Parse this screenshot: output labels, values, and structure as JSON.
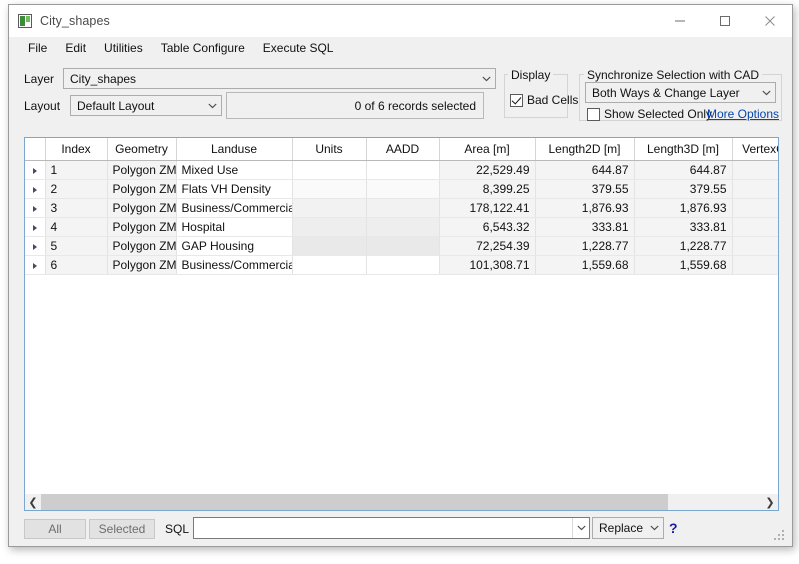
{
  "window": {
    "title": "City_shapes",
    "icon": "table-layer-icon",
    "controls": {
      "minimize": "minimize-icon",
      "maximize": "maximize-icon",
      "close": "close-icon"
    }
  },
  "menubar": {
    "items": [
      "File",
      "Edit",
      "Utilities",
      "Table Configure",
      "Execute SQL"
    ]
  },
  "options": {
    "layer_label": "Layer",
    "layer_value": "City_shapes",
    "layout_label": "Layout",
    "layout_value": "Default Layout",
    "records_status": "0 of 6 records selected",
    "display_group": "Display",
    "bad_cells_label": "Bad Cells",
    "bad_cells_checked": true,
    "sync_group": "Synchronize Selection with CAD",
    "sync_value": "Both Ways & Change Layer",
    "show_selected_only_label": "Show Selected Only",
    "show_selected_only_checked": false,
    "more_options_label": "More Options"
  },
  "grid": {
    "columns": [
      {
        "key": "marker",
        "label": ""
      },
      {
        "key": "index",
        "label": "Index"
      },
      {
        "key": "geometry",
        "label": "Geometry"
      },
      {
        "key": "landuse",
        "label": "Landuse"
      },
      {
        "key": "units",
        "label": "Units"
      },
      {
        "key": "aadd",
        "label": "AADD"
      },
      {
        "key": "area",
        "label": "Area [m]"
      },
      {
        "key": "length2d",
        "label": "Length2D [m]"
      },
      {
        "key": "length3d",
        "label": "Length3D [m]"
      },
      {
        "key": "vertexc",
        "label": "VertexC"
      }
    ],
    "rows": [
      {
        "index": "1",
        "geometry": "Polygon ZM",
        "landuse": "Mixed Use",
        "units": "",
        "aadd": "",
        "area": "22,529.49",
        "length2d": "644.87",
        "length3d": "644.87",
        "vertexc": ""
      },
      {
        "index": "2",
        "geometry": "Polygon ZM",
        "landuse": "Flats VH Density",
        "units": "",
        "aadd": "",
        "area": "8,399.25",
        "length2d": "379.55",
        "length3d": "379.55",
        "vertexc": ""
      },
      {
        "index": "3",
        "geometry": "Polygon ZM",
        "landuse": "Business/Commercial",
        "units": "",
        "aadd": "",
        "area": "178,122.41",
        "length2d": "1,876.93",
        "length3d": "1,876.93",
        "vertexc": ""
      },
      {
        "index": "4",
        "geometry": "Polygon ZM",
        "landuse": "Hospital",
        "units": "",
        "aadd": "",
        "area": "6,543.32",
        "length2d": "333.81",
        "length3d": "333.81",
        "vertexc": ""
      },
      {
        "index": "5",
        "geometry": "Polygon ZM",
        "landuse": "GAP Housing",
        "units": "",
        "aadd": "",
        "area": "72,254.39",
        "length2d": "1,228.77",
        "length3d": "1,228.77",
        "vertexc": ""
      },
      {
        "index": "6",
        "geometry": "Polygon ZM",
        "landuse": "Business/Commercial",
        "units": "",
        "aadd": "",
        "area": "101,308.71",
        "length2d": "1,559.68",
        "length3d": "1,559.68",
        "vertexc": ""
      }
    ]
  },
  "bottom": {
    "all_label": "All",
    "selected_label": "Selected",
    "sql_label": "SQL",
    "sql_value": "",
    "mode_value": "Replace",
    "help_label": "?"
  },
  "colors": {
    "accent_link": "#0645ad",
    "grid_border": "#7aa7d0",
    "chrome": "#f0f0f0",
    "scroll_thumb": "#cdcdcd",
    "help_blue": "#1a1aa8"
  }
}
